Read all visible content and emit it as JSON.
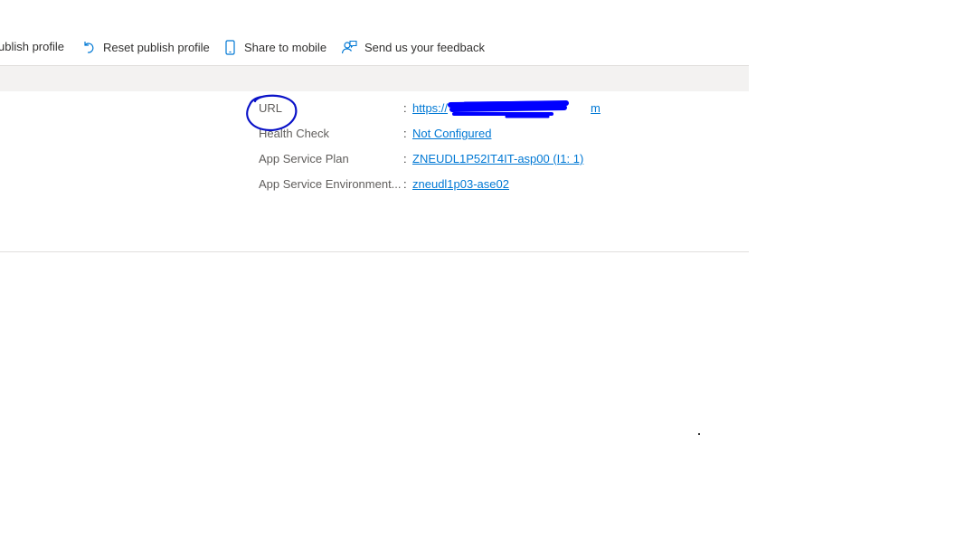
{
  "toolbar": {
    "items": [
      {
        "label": "ublish profile",
        "icon": "download-icon"
      },
      {
        "label": "Reset publish profile",
        "icon": "reset-icon"
      },
      {
        "label": "Share to mobile",
        "icon": "mobile-icon"
      },
      {
        "label": "Send us your feedback",
        "icon": "feedback-icon"
      }
    ]
  },
  "essentials": {
    "rows": [
      {
        "label": "URL",
        "value": "https://",
        "value_suffix": "m"
      },
      {
        "label": "Health Check",
        "value": "Not Configured"
      },
      {
        "label": "App Service Plan",
        "value": "ZNEUDL1P52IT4IT-asp00 (I1: 1)"
      },
      {
        "label": "App Service Environment...",
        "value": "zneudl1p03-ase02"
      }
    ],
    "separator": ":"
  },
  "colors": {
    "link": "#0078d4",
    "annotation": "#0000ff",
    "band": "#f3f2f1"
  }
}
